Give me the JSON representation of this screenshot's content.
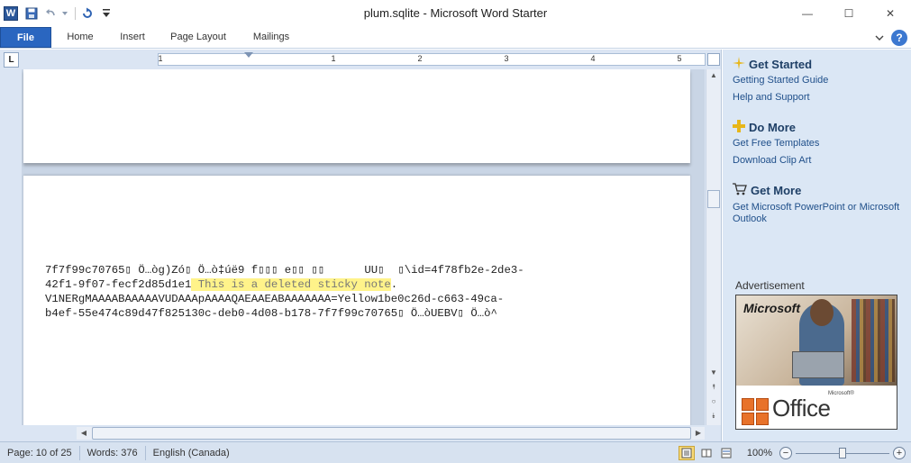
{
  "window": {
    "title": "plum.sqlite  -  Microsoft Word Starter",
    "app_icon": "W",
    "minimize_glyph": "—",
    "maximize_glyph": "☐",
    "close_glyph": "✕"
  },
  "ribbon": {
    "tabs": [
      "File",
      "Home",
      "Insert",
      "Page Layout",
      "Mailings"
    ],
    "help_glyph": "?"
  },
  "ruler": {
    "corner_glyph": "L",
    "numbers": [
      "1",
      "1",
      "2",
      "3",
      "4",
      "5"
    ]
  },
  "document": {
    "line1": "7f7f99c70765▯ Ö…òg)Zó▯ Ö…ò‡úë9 f▯▯▯ e▯▯ ▯▯      UU▯  ▯\\id=4f78fb2e-2de3-",
    "line2_prefix": "42f1-9f07-fecf2d85d1e1",
    "highlight": " This is a deleted sticky note",
    "line2_suffix": ".",
    "line3": "V1NERgMAAAABAAAAAVUDAAApAAAAQAEAAEABAAAAAAA=Yellow1be0c26d-c663-49ca-",
    "line4": "b4ef-55e474c89d47f825130c-deb0-4d08-b178-7f7f99c70765▯ Ö…òUEBV▯ Ö…ò^"
  },
  "pane": {
    "get_started": {
      "heading": "Get Started",
      "links": [
        "Getting Started Guide",
        "Help and Support"
      ]
    },
    "do_more": {
      "heading": "Do More",
      "links": [
        "Get Free Templates",
        "Download Clip Art"
      ]
    },
    "get_more": {
      "heading": "Get More",
      "links": [
        "Get Microsoft PowerPoint or Microsoft Outlook"
      ]
    },
    "ad_label": "Advertisement",
    "ad": {
      "brand": "Microsoft",
      "brand_small": "Microsoft®",
      "product": "Office"
    }
  },
  "status": {
    "page": "Page: 10 of 25",
    "words": "Words: 376",
    "language": "English (Canada)",
    "zoom": "100%",
    "zoom_level_percent": 100,
    "zoom_minus": "−",
    "zoom_plus": "+"
  }
}
